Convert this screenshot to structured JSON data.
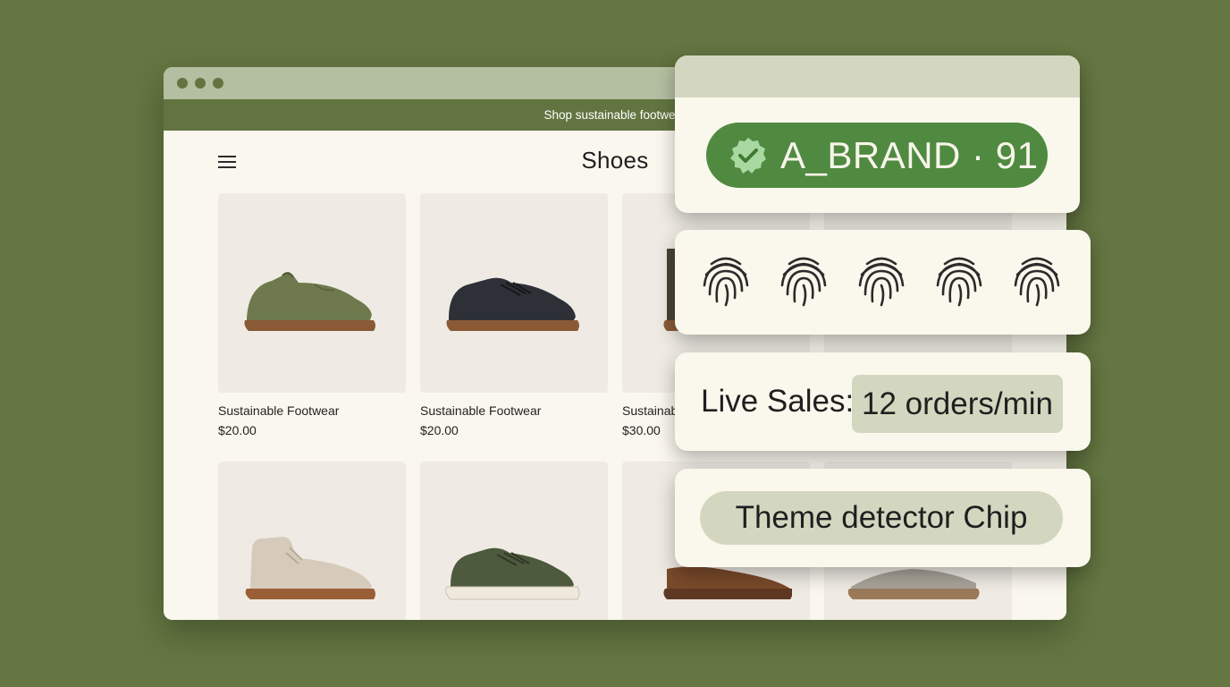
{
  "browser": {
    "announcement": "Shop sustainable footwear",
    "page_title": "Shoes",
    "products": [
      {
        "name": "Sustainable Footwear",
        "price": "$20.00",
        "shoe": "slip-on-olive"
      },
      {
        "name": "Sustainable Footwear",
        "price": "$20.00",
        "shoe": "sneaker-black"
      },
      {
        "name": "Sustainab",
        "price": "$30.00",
        "shoe": "boot-brown"
      },
      {
        "name": "",
        "price": "",
        "shoe": ""
      },
      {
        "name": "",
        "price": "",
        "shoe": "chukka-beige"
      },
      {
        "name": "",
        "price": "",
        "shoe": "sneaker-olive"
      },
      {
        "name": "",
        "price": "",
        "shoe": "loafer-brown"
      },
      {
        "name": "",
        "price": "",
        "shoe": "clog-grey"
      }
    ]
  },
  "overlays": {
    "brand_badge": {
      "text": "A_BRAND · 91",
      "icon": "verified-check-icon",
      "color": "#4f8a40"
    },
    "fingerprints": {
      "icon": "fingerprint-icon",
      "count": 5
    },
    "live_sales": {
      "label": "Live Sales:",
      "value": "12 orders/min"
    },
    "theme_chip": {
      "label": "Theme detector Chip"
    }
  },
  "colors": {
    "background": "#647641",
    "accent": "#627540",
    "surface": "#faf7ee",
    "chip": "#d3d7c0"
  }
}
